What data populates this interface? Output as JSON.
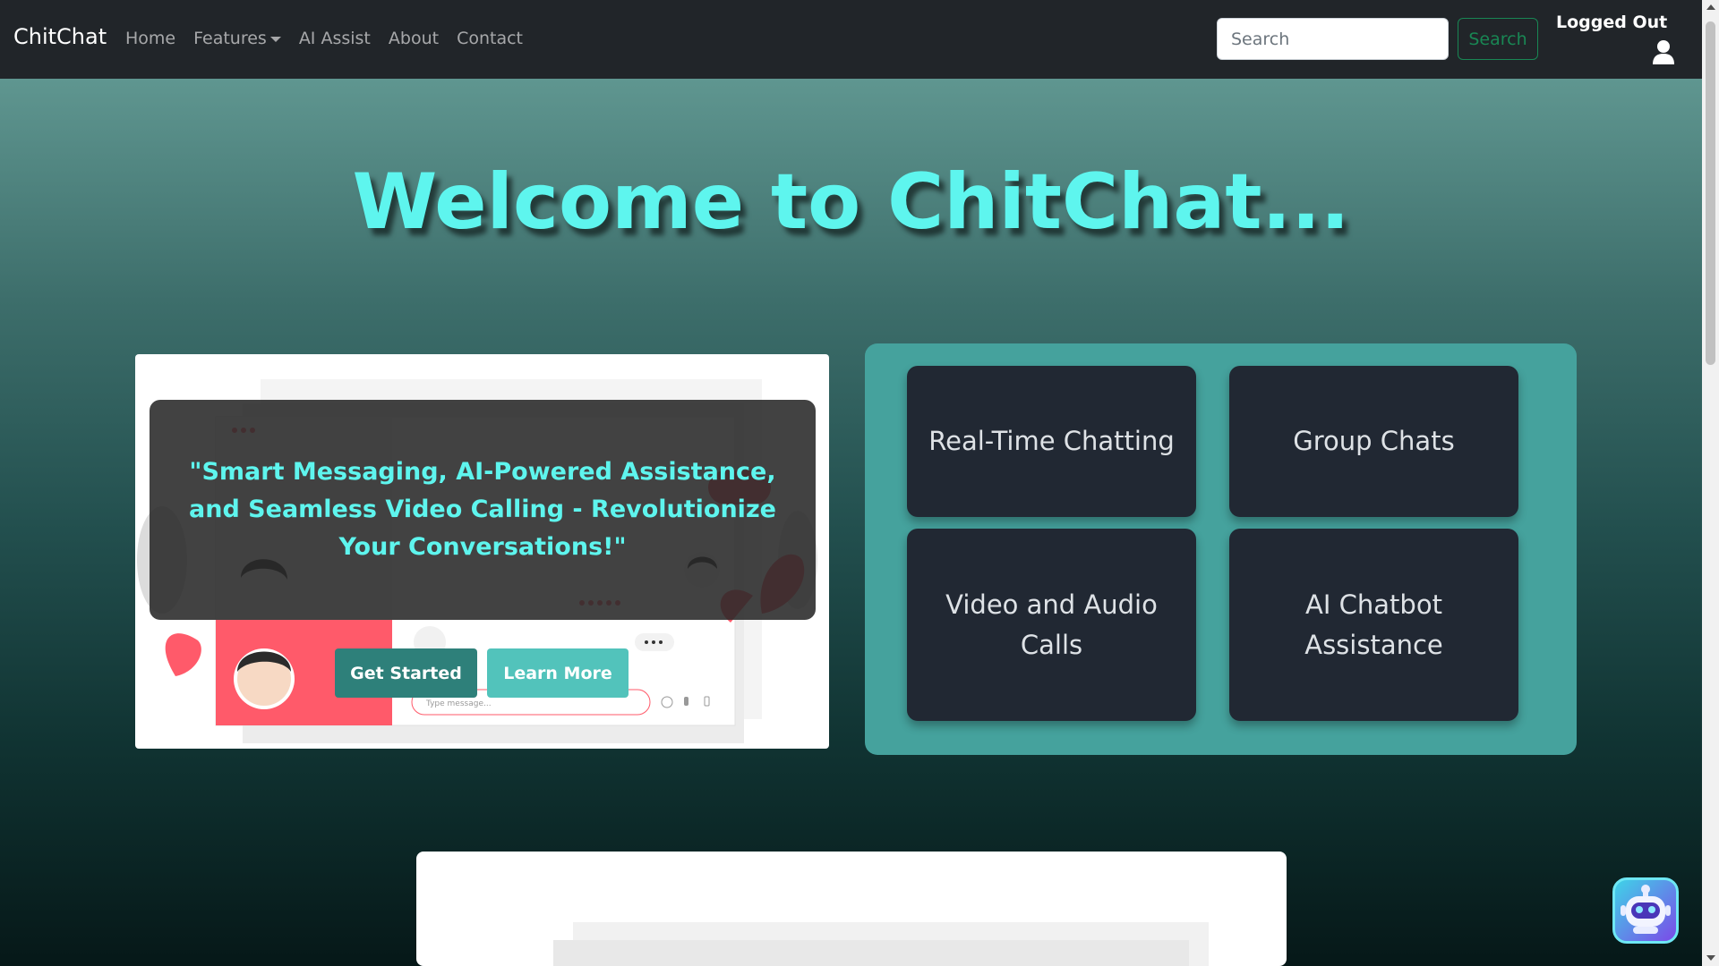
{
  "navbar": {
    "brand": "ChitChat",
    "links": [
      {
        "label": "Home"
      },
      {
        "label": "Features"
      },
      {
        "label": "AI Assist"
      },
      {
        "label": "About"
      },
      {
        "label": "Contact"
      }
    ],
    "search_placeholder": "Search",
    "search_button": "Search",
    "login_status": "Logged Out",
    "user_icon": "user-icon"
  },
  "hero": {
    "title": "Welcome to ChitChat...",
    "tagline": "\"Smart Messaging, AI-Powered Assistance, and Seamless Video Calling - Revolutionize Your Conversations!\"",
    "get_started": "Get Started",
    "learn_more": "Learn More",
    "illustration_input_text": "Type message..."
  },
  "features": [
    {
      "label": "Real-Time Chatting"
    },
    {
      "label": "Group Chats"
    },
    {
      "label": "Video and Audio Calls"
    },
    {
      "label": "AI Chatbot Assistance"
    }
  ],
  "chatbot": {
    "icon": "robot-icon"
  },
  "colors": {
    "accent": "#5ef5ee",
    "navbar": "#212529",
    "panel": "#45a29d",
    "card": "#212833",
    "primary_button": "#2e807a",
    "secondary_button": "#52c3bb",
    "search_outline": "#198754"
  }
}
